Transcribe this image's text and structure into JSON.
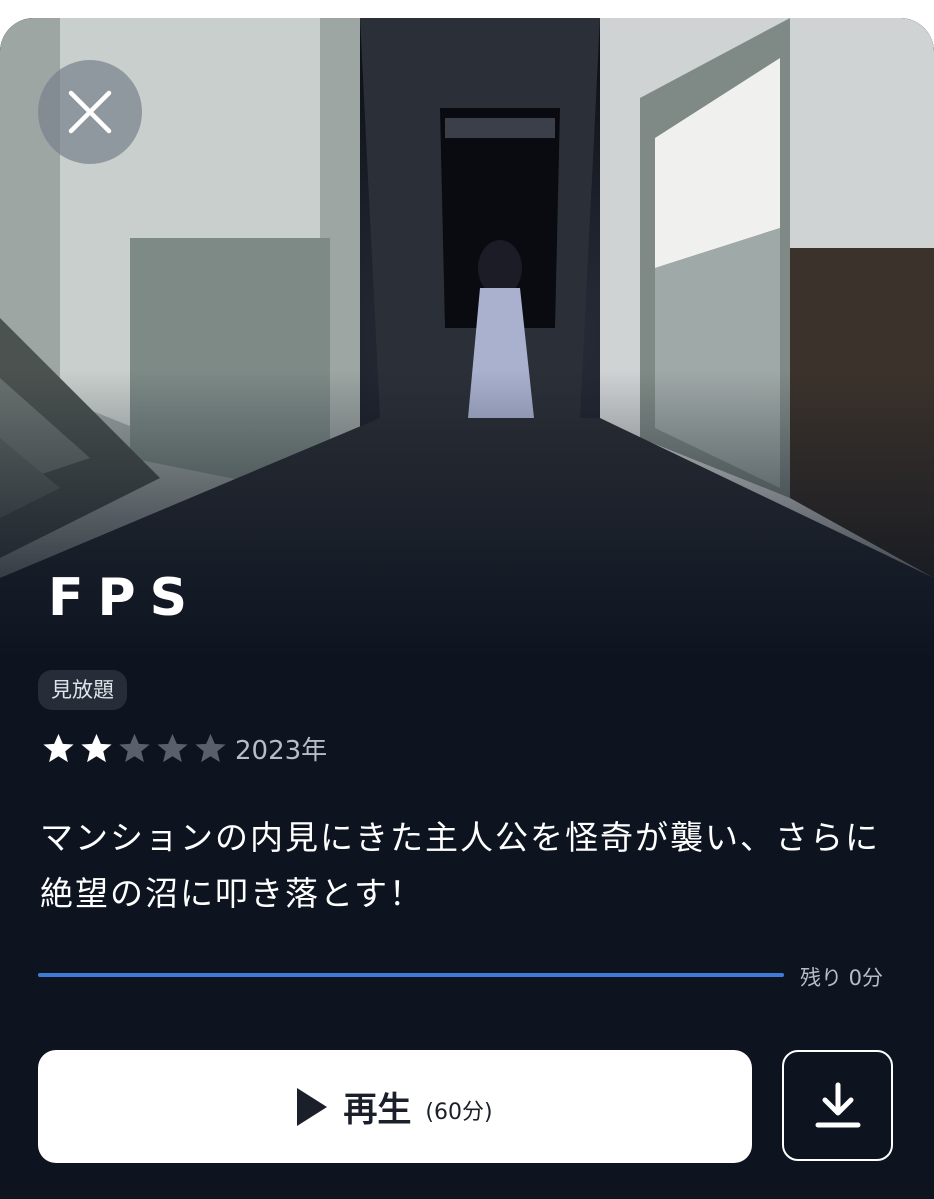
{
  "title": "FPS",
  "badge": "見放題",
  "rating": {
    "value": 2,
    "max": 5
  },
  "year": "2023年",
  "description": "マンションの内見にきた主人公を怪奇が襲い、さらに絶望の沼に叩き落とす！",
  "progress": {
    "fraction": 1.0,
    "remaining_label": "残り 0分"
  },
  "play_button": {
    "label": "再生",
    "duration": "(60分)"
  },
  "icons": {
    "close": "close-icon",
    "play": "play-icon",
    "download": "download-icon",
    "star": "star-icon"
  },
  "colors": {
    "background": "#0d1420",
    "accent": "#3d7bd6",
    "star_filled": "#ffffff",
    "star_empty": "#5a606b"
  }
}
